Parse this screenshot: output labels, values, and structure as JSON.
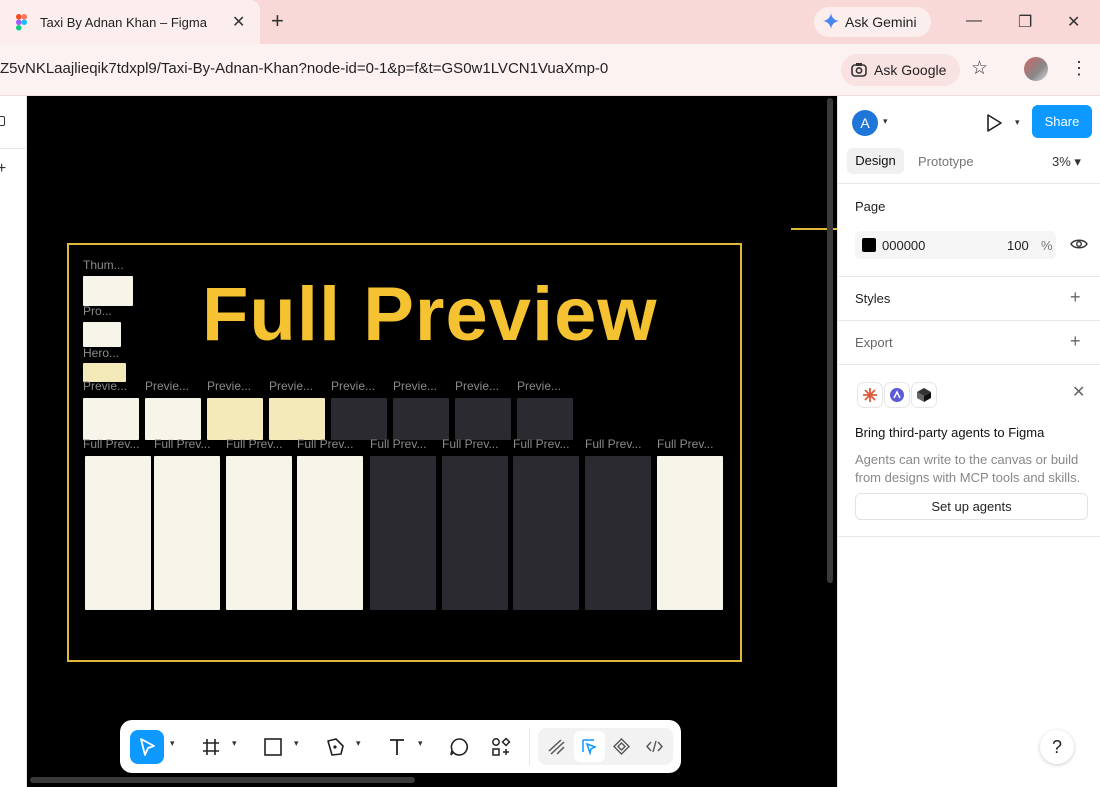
{
  "browser": {
    "tab_title": "Taxi By Adnan Khan – Figma",
    "new_tab": "+",
    "ask_gemini": "Ask Gemini",
    "url": "Z5vNKLaajlieqik7tdxpl9/Taxi-By-Adnan-Khan?node-id=0-1&p=f&t=GS0w1LVCN1VuaXmp-0",
    "ask_google": "Ask Google",
    "window_controls": [
      "minimize-icon",
      "restore-icon",
      "close-icon"
    ]
  },
  "canvas": {
    "background": "#000000",
    "frame_border": "#e0b93a",
    "title": "Full Preview",
    "title_color": "#f5c232",
    "labels": {
      "thumb": "Thum...",
      "pro": "Pro...",
      "hero": "Hero..."
    },
    "preview_labels": [
      "Previe...",
      "Previe...",
      "Previe...",
      "Previe...",
      "Previe...",
      "Previe...",
      "Previe...",
      "Previe..."
    ],
    "full_preview_labels": [
      "Full Prev...",
      "Full Prev...",
      "Full Prev...",
      "Full Prev...",
      "Full Prev...",
      "Full Prev...",
      "Full Prev...",
      "Full Prev...",
      "Full Prev..."
    ]
  },
  "toolbar": {
    "tools": [
      "move-tool",
      "frame-tool",
      "rectangle-tool",
      "pen-tool",
      "text-tool",
      "comment-tool",
      "actions-tool"
    ],
    "right_tools": [
      "draw-mode",
      "design-mode",
      "dev-mode",
      "code-mode"
    ],
    "accent": "#0d99ff"
  },
  "help": "?",
  "panel": {
    "avatar_letter": "A",
    "share_label": "Share",
    "tabs": {
      "design": "Design",
      "prototype": "Prototype"
    },
    "zoom": "3%",
    "page": {
      "title": "Page",
      "color_hex": "000000",
      "opacity": "100",
      "percent": "%"
    },
    "styles": "Styles",
    "export": "Export",
    "agents": {
      "title": "Bring third-party agents to Figma",
      "description": "Agents can write to the canvas or build from designs with MCP tools and skills.",
      "button": "Set up agents"
    }
  }
}
